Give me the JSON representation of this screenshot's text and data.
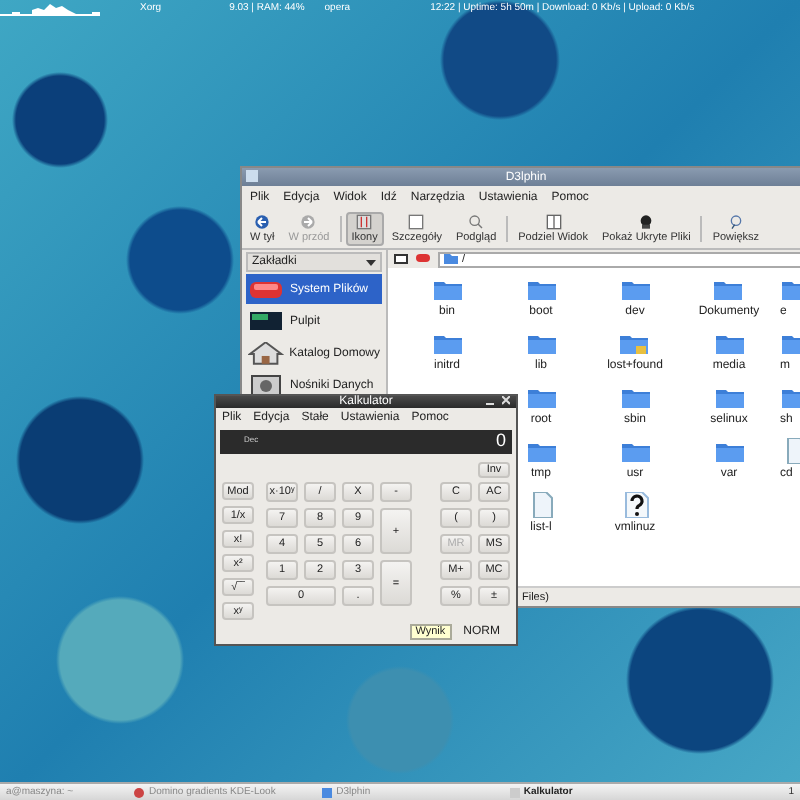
{
  "top_panel": {
    "texts": [
      "Xorg",
      "9.03 | RAM: 44%",
      "opera",
      "12:22  |  Uptime: 5h 50m  |  Download: 0 Kb/s | Upload: 0 Kb/s"
    ]
  },
  "dolphin": {
    "title": "D3lphin",
    "menu": [
      "Plik",
      "Edycja",
      "Widok",
      "Idź",
      "Narzędzia",
      "Ustawienia",
      "Pomoc"
    ],
    "toolbar": [
      {
        "label": "W tył",
        "kind": "back",
        "disabled": false,
        "selected": false
      },
      {
        "label": "W przód",
        "kind": "forward",
        "disabled": true,
        "selected": false
      },
      {
        "label": "Ikony",
        "kind": "icons",
        "disabled": false,
        "selected": true
      },
      {
        "label": "Szczegóły",
        "kind": "details",
        "disabled": false,
        "selected": false
      },
      {
        "label": "Podgląd",
        "kind": "preview",
        "disabled": false,
        "selected": false
      },
      {
        "label": "Podziel Widok",
        "kind": "split",
        "disabled": false,
        "selected": false
      },
      {
        "label": "Pokaż Ukryte Pliki",
        "kind": "hidden",
        "disabled": false,
        "selected": false
      },
      {
        "label": "Powiększ",
        "kind": "zoom",
        "disabled": false,
        "selected": false
      }
    ],
    "sidebar": {
      "dropdown": "Zakładki",
      "items": [
        {
          "label": "System Plików",
          "kind": "drive",
          "selected": true
        },
        {
          "label": "Pulpit",
          "kind": "desktop",
          "selected": false
        },
        {
          "label": "Katalog Domowy",
          "kind": "home",
          "selected": false
        },
        {
          "label": "Nośniki Danych",
          "kind": "media",
          "selected": false
        }
      ]
    },
    "location": "/",
    "rows": [
      [
        {
          "name": "bin",
          "kind": "folder"
        },
        {
          "name": "boot",
          "kind": "folder"
        },
        {
          "name": "dev",
          "kind": "folder"
        },
        {
          "name": "Dokumenty",
          "kind": "folder"
        },
        {
          "name": "e",
          "kind": "folder"
        }
      ],
      [
        {
          "name": "initrd",
          "kind": "folder"
        },
        {
          "name": "lib",
          "kind": "folder"
        },
        {
          "name": "lost+found",
          "kind": "locked"
        },
        {
          "name": "media",
          "kind": "folder"
        },
        {
          "name": "m",
          "kind": "folder"
        }
      ],
      [
        {
          "name": "root",
          "kind": "folder"
        },
        {
          "name": "sbin",
          "kind": "folder"
        },
        {
          "name": "selinux",
          "kind": "folder"
        },
        {
          "name": "sh",
          "kind": "folder"
        }
      ],
      [
        {
          "name": "tmp",
          "kind": "folder"
        },
        {
          "name": "usr",
          "kind": "folder"
        },
        {
          "name": "var",
          "kind": "folder"
        },
        {
          "name": "cd",
          "kind": "file"
        }
      ],
      [
        {
          "name": "list-l",
          "kind": "file"
        },
        {
          "name": "vmlinuz",
          "kind": "unknown"
        }
      ]
    ],
    "status": "Files)"
  },
  "calculator": {
    "title": "Kalkulator",
    "menu": [
      "Plik",
      "Edycja",
      "Stałe",
      "Ustawienia",
      "Pomoc"
    ],
    "display": {
      "base": "Dec",
      "value": "0"
    },
    "inv": "Inv",
    "functions": [
      "Mod",
      "1/x",
      "x!",
      "x²",
      "√‾‾",
      "xʸ"
    ],
    "keys": [
      {
        "label": "x·10ʸ",
        "kind": "key"
      },
      {
        "label": "/",
        "kind": "key"
      },
      {
        "label": "X",
        "kind": "key"
      },
      {
        "label": "-",
        "kind": "key"
      },
      {
        "label": "7",
        "kind": "key"
      },
      {
        "label": "8",
        "kind": "key"
      },
      {
        "label": "9",
        "kind": "key"
      },
      {
        "label": "+",
        "kind": "tall"
      },
      {
        "label": "4",
        "kind": "key"
      },
      {
        "label": "5",
        "kind": "key"
      },
      {
        "label": "6",
        "kind": "key"
      },
      {
        "label": "1",
        "kind": "key"
      },
      {
        "label": "2",
        "kind": "key"
      },
      {
        "label": "3",
        "kind": "key"
      },
      {
        "label": "=",
        "kind": "tall"
      },
      {
        "label": "0",
        "kind": "wide"
      },
      {
        "label": ".",
        "kind": "key"
      }
    ],
    "memory": [
      {
        "label": "C",
        "disabled": false
      },
      {
        "label": "AC",
        "disabled": false
      },
      {
        "label": "(",
        "disabled": false
      },
      {
        "label": ")",
        "disabled": false
      },
      {
        "label": "MR",
        "disabled": true
      },
      {
        "label": "MS",
        "disabled": false
      },
      {
        "label": "M+",
        "disabled": false
      },
      {
        "label": "MC",
        "disabled": false
      },
      {
        "label": "%",
        "disabled": false
      },
      {
        "label": "±",
        "disabled": false
      }
    ],
    "tooltip": "Wynik",
    "mode": "NORM"
  },
  "taskbar": {
    "tasks": [
      {
        "label": "a@maszyna: ~",
        "kind": "terminal",
        "selected": false
      },
      {
        "label": "Domino gradients KDE-Look",
        "kind": "browser",
        "selected": false
      },
      {
        "label": "D3lphin",
        "kind": "files",
        "selected": false
      },
      {
        "label": "Kalkulator",
        "kind": "calc",
        "selected": true
      }
    ],
    "desktop": "1"
  }
}
